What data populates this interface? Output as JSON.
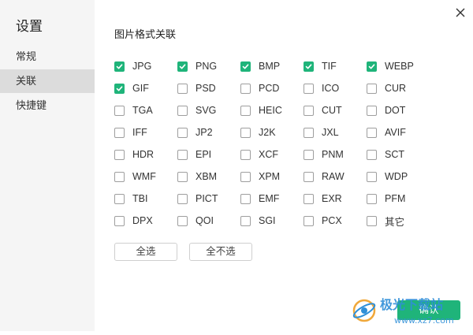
{
  "sidebar": {
    "title": "设置",
    "items": [
      {
        "label": "常规"
      },
      {
        "label": "关联"
      },
      {
        "label": "快捷键"
      }
    ]
  },
  "main": {
    "section_title": "图片格式关联",
    "rows": [
      [
        {
          "label": "JPG",
          "checked": true
        },
        {
          "label": "PNG",
          "checked": true
        },
        {
          "label": "BMP",
          "checked": true
        },
        {
          "label": "TIF",
          "checked": true
        },
        {
          "label": "WEBP",
          "checked": true
        }
      ],
      [
        {
          "label": "GIF",
          "checked": true
        },
        {
          "label": "PSD",
          "checked": false
        },
        {
          "label": "PCD",
          "checked": false
        },
        {
          "label": "ICO",
          "checked": false
        },
        {
          "label": "CUR",
          "checked": false
        }
      ],
      [
        {
          "label": "TGA",
          "checked": false
        },
        {
          "label": "SVG",
          "checked": false
        },
        {
          "label": "HEIC",
          "checked": false
        },
        {
          "label": "CUT",
          "checked": false
        },
        {
          "label": "DOT",
          "checked": false
        }
      ],
      [
        {
          "label": "IFF",
          "checked": false
        },
        {
          "label": "JP2",
          "checked": false
        },
        {
          "label": "J2K",
          "checked": false
        },
        {
          "label": "JXL",
          "checked": false
        },
        {
          "label": "AVIF",
          "checked": false
        }
      ],
      [
        {
          "label": "HDR",
          "checked": false
        },
        {
          "label": "EPI",
          "checked": false
        },
        {
          "label": "XCF",
          "checked": false
        },
        {
          "label": "PNM",
          "checked": false
        },
        {
          "label": "SCT",
          "checked": false
        }
      ],
      [
        {
          "label": "WMF",
          "checked": false
        },
        {
          "label": "XBM",
          "checked": false
        },
        {
          "label": "XPM",
          "checked": false
        },
        {
          "label": "RAW",
          "checked": false
        },
        {
          "label": "WDP",
          "checked": false
        }
      ],
      [
        {
          "label": "TBI",
          "checked": false
        },
        {
          "label": "PICT",
          "checked": false
        },
        {
          "label": "EMF",
          "checked": false
        },
        {
          "label": "EXR",
          "checked": false
        },
        {
          "label": "PFM",
          "checked": false
        }
      ],
      [
        {
          "label": "DPX",
          "checked": false
        },
        {
          "label": "QOI",
          "checked": false
        },
        {
          "label": "SGI",
          "checked": false
        },
        {
          "label": "PCX",
          "checked": false
        },
        {
          "label": "其它",
          "checked": false
        }
      ]
    ],
    "select_all_label": "全选",
    "select_none_label": "全不选"
  },
  "footer": {
    "confirm_label": "确认"
  },
  "watermark": {
    "text": "极光下载站",
    "url": "www.xz7.com"
  },
  "colors": {
    "accent": "#1fb47a",
    "sidebar_bg": "#f5f5f5",
    "sidebar_active_bg": "#dcdcdc"
  },
  "icons": {
    "close": "close-icon",
    "checkbox_check": "check-icon"
  }
}
